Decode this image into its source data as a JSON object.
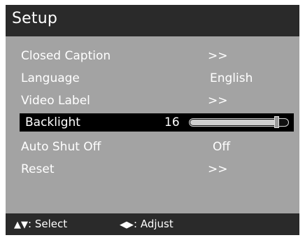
{
  "title": "Setup",
  "menu": {
    "items": [
      {
        "label": "Closed Caption",
        "value": ">>"
      },
      {
        "label": "Language",
        "value": "English"
      },
      {
        "label": "Video Label",
        "value": ">>"
      },
      {
        "label": "Backlight",
        "value": "16",
        "level": 0.9
      },
      {
        "label": "Auto Shut Off",
        "value": "Off"
      },
      {
        "label": "Reset",
        "value": ">>"
      }
    ]
  },
  "footer": {
    "select_icons": "▲▼",
    "select_label": ": Select",
    "adjust_icons": "◀▶",
    "adjust_label": ": Adjust"
  },
  "colors": {
    "title_bar": "#2a2a2a",
    "menu_background": "#a3a3a3",
    "selected_row": "#000000",
    "text": "#ffffff"
  }
}
